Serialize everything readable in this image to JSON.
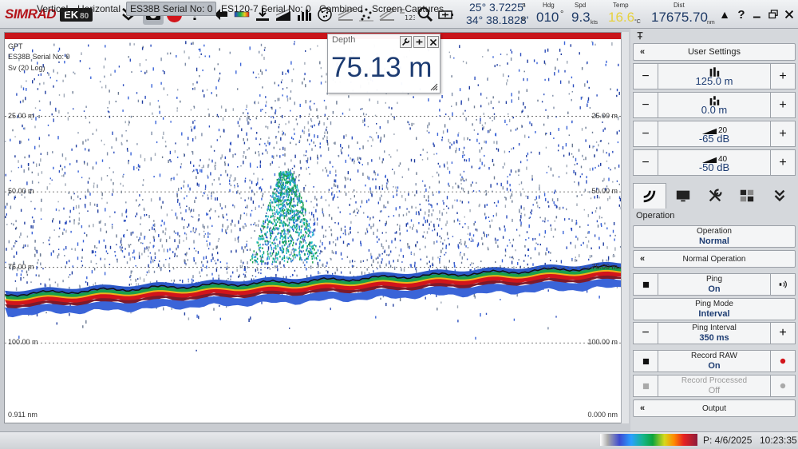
{
  "app": {
    "brand": "SIMRAD",
    "model": "EK",
    "model_suffix": "80"
  },
  "toolbar": {
    "rec_label": "REC",
    "exclaim": "!",
    "lat": "25° 3.7225'",
    "lat_hem": "S",
    "lon": "34° 38.1828'",
    "lon_hem": "E",
    "heading_label": "Hdg",
    "heading_value": "010",
    "heading_unit": "°",
    "speed_label": "Spd",
    "speed_value": "9.3",
    "speed_unit": "kts",
    "temp_label": "Temp",
    "temp_value": "16.6",
    "temp_unit": "°C",
    "dist_label": "Dist",
    "dist_value": "17675.70",
    "dist_unit": "nm",
    "warning_glyph": "▲",
    "help_glyph": "?"
  },
  "echogram": {
    "header_lines": [
      "GPT",
      "ES38B Serial No: 0",
      "Sv (20 Log)"
    ],
    "depth_lines": [
      {
        "label": "25.00 m",
        "depth_m": 25
      },
      {
        "label": "50.00 m",
        "depth_m": 50
      },
      {
        "label": "75.00 m",
        "depth_m": 75
      },
      {
        "label": "100.00 m",
        "depth_m": 100
      }
    ],
    "range_m": 125,
    "bottom_left": "0.911 nm",
    "bottom_right": "0.000 nm"
  },
  "depth_box": {
    "title": "Depth",
    "value": "75.13 m"
  },
  "panel": {
    "user_settings": "User Settings",
    "range_value": "125.0 m",
    "start_value": "0.0 m",
    "gain_tvg": "20",
    "gain_value": "-65 dB",
    "threshold_tvg": "40",
    "threshold_value": "-50 dB",
    "section_title": "Operation",
    "operation_label": "Operation",
    "operation_value": "Normal",
    "normal_operation": "Normal Operation",
    "ping_label": "Ping",
    "ping_value": "On",
    "ping_mode_label": "Ping Mode",
    "ping_mode_value": "Interval",
    "ping_interval_label": "Ping Interval",
    "ping_interval_value": "350 ms",
    "record_raw_label": "Record RAW",
    "record_raw_value": "On",
    "record_processed_label": "Record Processed",
    "record_processed_value": "Off",
    "output_label": "Output",
    "minus": "−",
    "plus": "+"
  },
  "bottom": {
    "tabs": [
      "Vertical",
      "Horizontal",
      "ES38B Serial No: 0",
      "ES120-7 Serial No: 0",
      "Combined",
      "Screen Captures"
    ],
    "active_tab": 2,
    "date": "P: 4/6/2025",
    "time": "10:23:35"
  },
  "colors": {
    "accent_text": "#1d3c72",
    "bottom_echo_red": "#c8141a",
    "temp_text": "#e7d23f"
  }
}
